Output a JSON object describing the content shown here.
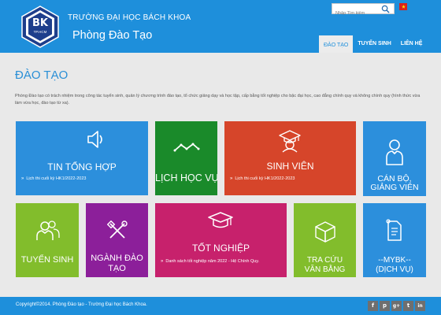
{
  "header": {
    "logo_main": "BK",
    "logo_sub": "TP.HCM",
    "university": "TRƯỜNG ĐẠI HỌC BÁCH KHOA",
    "department": "Phòng Đào Tạo",
    "search_placeholder": "Nhập Tìm kiếm",
    "brand_color": "#1e8fdb"
  },
  "nav": {
    "items": [
      "ĐÀO TẠO",
      "TUYỂN SINH",
      "LIÊN HỆ"
    ],
    "active": "ĐÀO TẠO"
  },
  "main": {
    "title": "ĐÀO TẠO",
    "description": "Phòng Đào tạo có trách nhiệm trong công tác tuyển sinh, quản lý chương trình đào tạo, tổ chức giảng dạy và học tập, cấp bằng tốt nghiệp cho bậc đại học, cao đẳng chính quy và không chính quy (hình thức vừa làm vừa học, đào tạo từ xa)."
  },
  "tiles": [
    {
      "title": "TIN TỔNG HỢP",
      "subtitle": "Lịch thi cuối kỳ HK1/2022-2023",
      "icon": "speaker-icon",
      "color": "#2c8fdc"
    },
    {
      "title": "LỊCH HỌC VỤ",
      "icon": "line-chart-icon",
      "color": "#1a8a2a"
    },
    {
      "title": "SINH VIÊN",
      "subtitle": "Lịch thi cuối kỳ HK1/2022-2023",
      "icon": "student-icon",
      "color": "#d6452a"
    },
    {
      "title_line1": "CÁN BỘ,",
      "title_line2": "GIẢNG VIÊN",
      "icon": "person-icon",
      "color": "#2c8fdc"
    },
    {
      "title": "TUYỂN SINH",
      "icon": "users-icon",
      "color": "#82bd2c"
    },
    {
      "title_line1": "NGÀNH ĐÀO",
      "title_line2": "TẠO",
      "icon": "tools-icon",
      "color": "#8c1f9a"
    },
    {
      "title": "TỐT NGHIỆP",
      "subtitle": "Danh sách tốt nghiệp năm 2022 - Hệ Chính Quy.",
      "icon": "graduation-cap-icon",
      "color": "#c7216c"
    },
    {
      "title_line1": "TRA CỨU",
      "title_line2": "VĂN BẰNG",
      "icon": "box-icon",
      "color": "#82bd2c"
    },
    {
      "title_line1": "--MYBK--",
      "title_line2": "(DỊCH VỤ)",
      "icon": "document-icon",
      "color": "#2c8fdc"
    }
  ],
  "footer": {
    "copyright": "Copyright©2014. Phòng Đào tạo - Trường Đại học Bách Khoa.",
    "social": [
      "f",
      "p",
      "g+",
      "t",
      "in"
    ]
  }
}
